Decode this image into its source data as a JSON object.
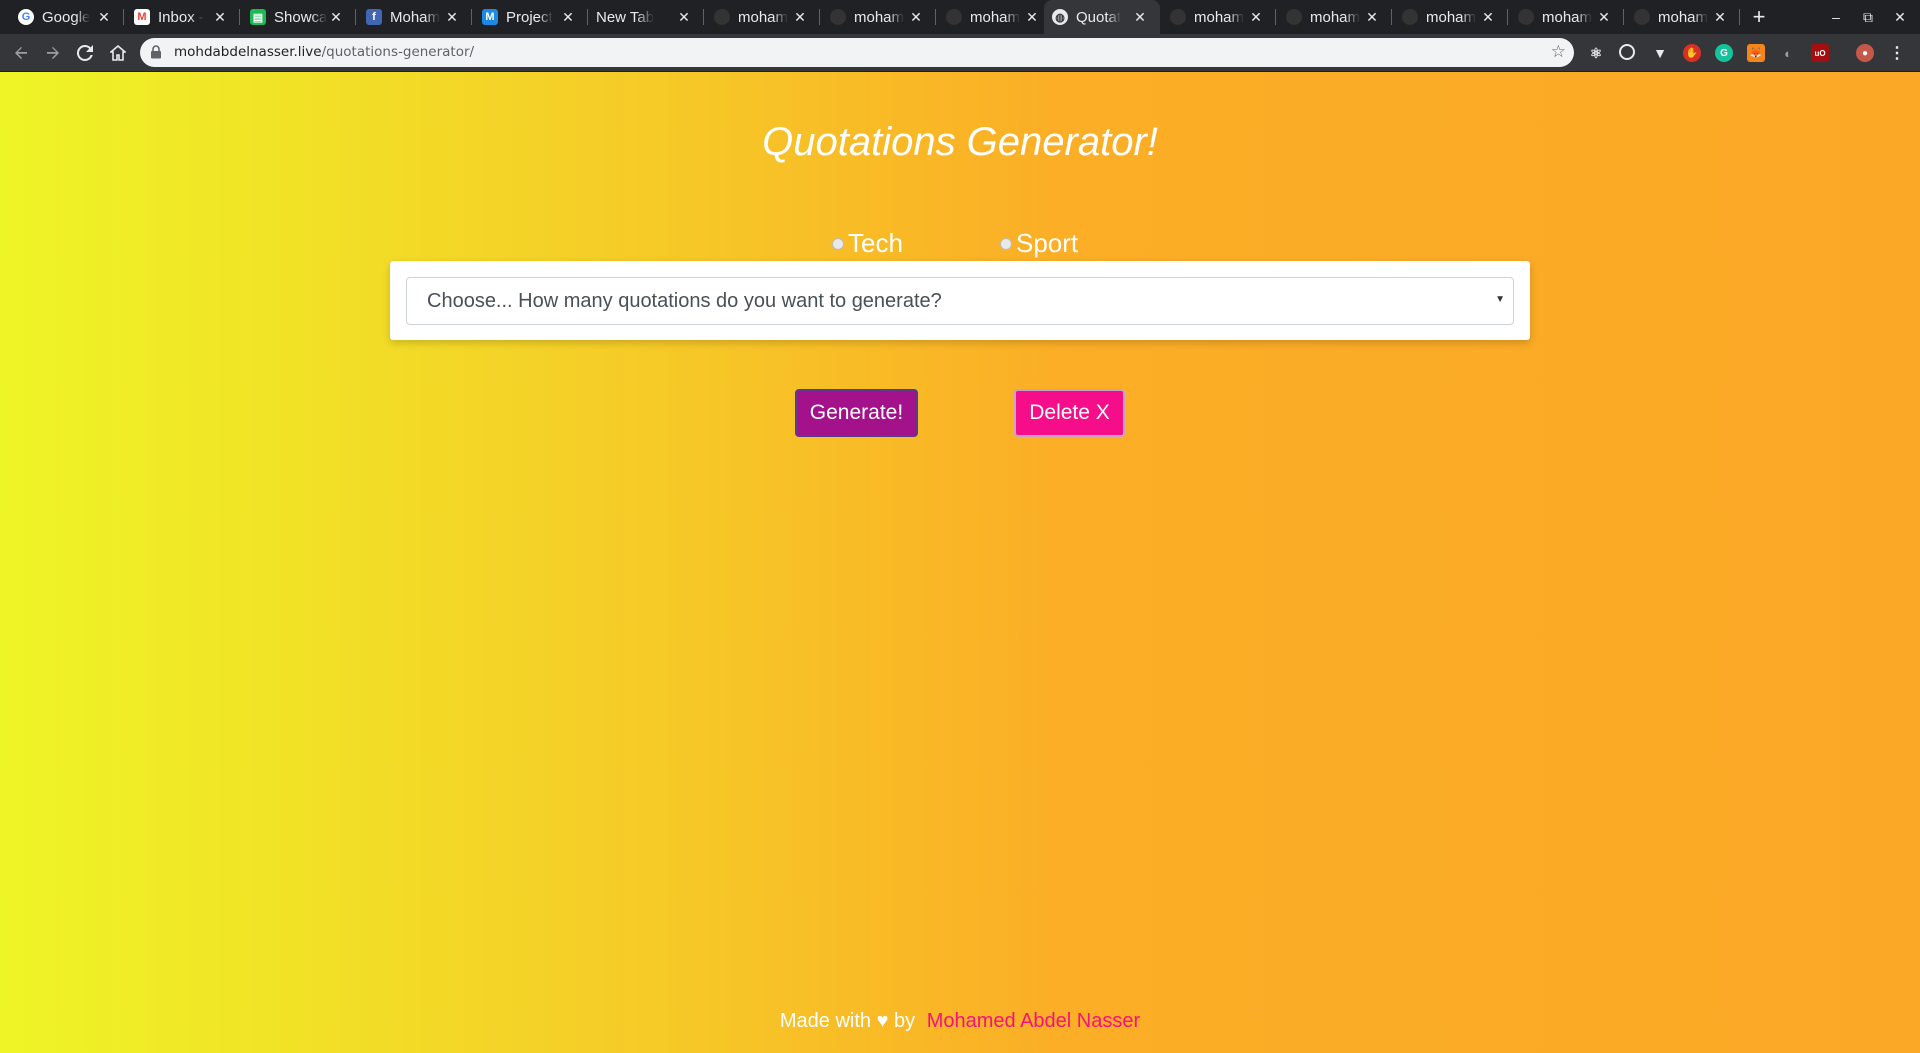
{
  "browser": {
    "tabs": [
      {
        "title": "Google",
        "icon": "google-icon",
        "color": "#ffffff"
      },
      {
        "title": "Inbox -",
        "icon": "gmail-icon",
        "color": "#ea4335"
      },
      {
        "title": "Showca",
        "icon": "sheets-icon",
        "color": "#1db954"
      },
      {
        "title": "Moham",
        "icon": "facebook-icon",
        "color": "#4267b2"
      },
      {
        "title": "Project",
        "icon": "m-icon",
        "color": "#1e88e5"
      },
      {
        "title": "New Tab",
        "icon": "",
        "color": ""
      },
      {
        "title": "moham",
        "icon": "github-icon",
        "color": "#333333"
      },
      {
        "title": "moham",
        "icon": "github-icon",
        "color": "#333333"
      },
      {
        "title": "moham",
        "icon": "github-icon",
        "color": "#333333"
      },
      {
        "title": "Quotat",
        "icon": "globe-icon",
        "color": "#e8eaed"
      },
      {
        "title": "moham",
        "icon": "github-icon",
        "color": "#333333"
      },
      {
        "title": "moham",
        "icon": "github-icon",
        "color": "#333333"
      },
      {
        "title": "moham",
        "icon": "github-icon",
        "color": "#333333"
      },
      {
        "title": "moham",
        "icon": "github-icon",
        "color": "#333333"
      },
      {
        "title": "moham",
        "icon": "github-icon",
        "color": "#333333"
      }
    ],
    "active_tab_index": 9,
    "url_domain": "mohdabdelnasser.live",
    "url_path": "/quotations-generator/"
  },
  "page": {
    "title": "Quotations Generator!",
    "radios": [
      {
        "label": "Tech",
        "checked": false
      },
      {
        "label": "Sport",
        "checked": false
      }
    ],
    "select_placeholder": "Choose... How many quotations do you want to generate?",
    "generate_label": "Generate!",
    "delete_label": "Delete X",
    "footer_prefix": "Made with ♥ by",
    "footer_author": "Mohamed Abdel Nasser"
  },
  "colors": {
    "generate_button": "#a3128b",
    "delete_button": "#f60d8a",
    "author_link": "#f5127f"
  }
}
